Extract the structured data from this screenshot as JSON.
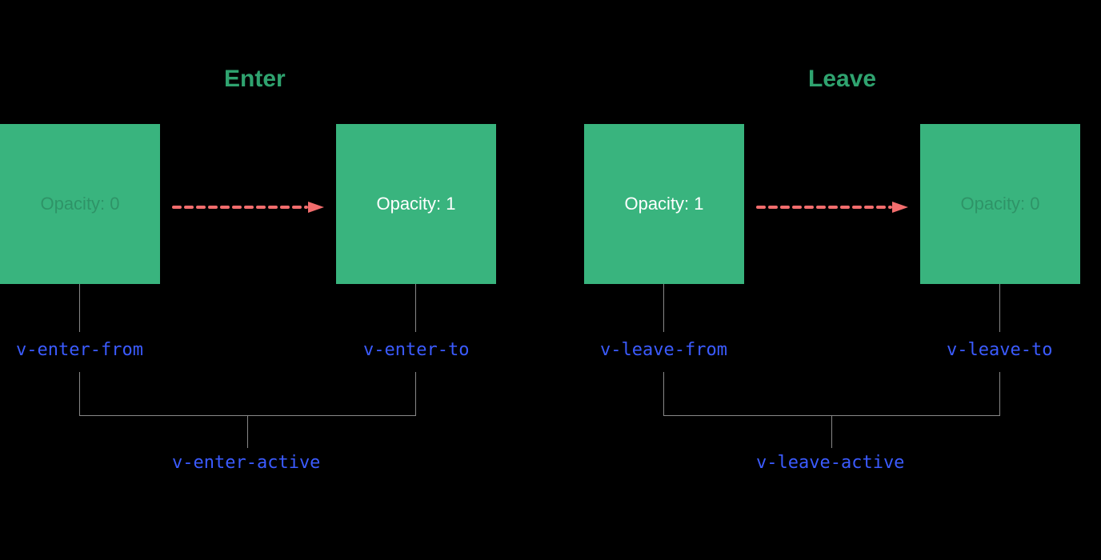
{
  "enter": {
    "title": "Enter",
    "from_box": {
      "text": "Opacity: 0"
    },
    "to_box": {
      "text": "Opacity: 1"
    },
    "from_label": "v-enter-from",
    "to_label": "v-enter-to",
    "active_label": "v-enter-active"
  },
  "leave": {
    "title": "Leave",
    "from_box": {
      "text": "Opacity: 1"
    },
    "to_box": {
      "text": "Opacity: 0"
    },
    "from_label": "v-leave-from",
    "to_label": "v-leave-to",
    "active_label": "v-leave-active"
  }
}
